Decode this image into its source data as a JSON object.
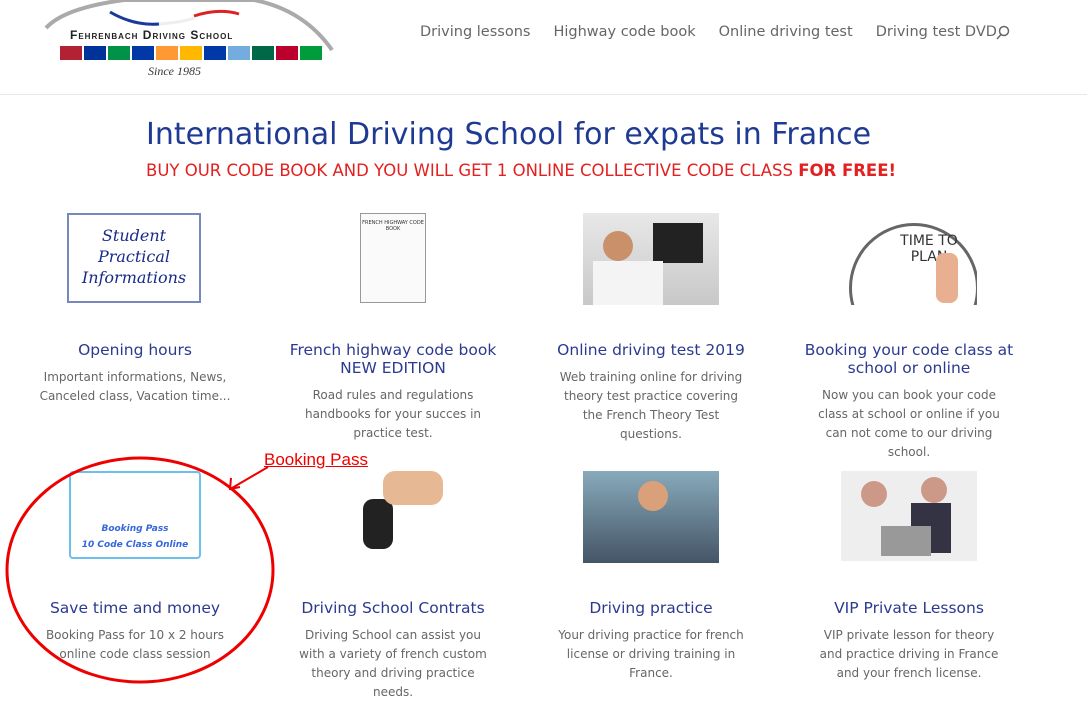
{
  "logo": {
    "name": "Fehrenbach Driving School",
    "since": "Since 1985",
    "flag_colors": [
      "#b22234",
      "#003399",
      "#009246",
      "#0039a6",
      "#ff9933",
      "#ffb700",
      "#0038a8",
      "#74acdf",
      "#006847",
      "#bc002d",
      "#009c3b"
    ]
  },
  "nav": [
    "Driving lessons",
    "Highway code book",
    "Online driving test",
    "Driving test DVD"
  ],
  "search_icon": "search-icon",
  "hero": {
    "title": "International Driving School for expats in France",
    "promo": "BUY OUR CODE BOOK AND YOU WILL GET 1 ONLINE COLLECTIVE CODE CLASS ",
    "promo_bold": "FOR FREE!"
  },
  "cards": [
    {
      "title": "Opening hours",
      "text": "Important informations, News, Canceled class, Vacation time...",
      "image_text": "Student Practical Informations"
    },
    {
      "title": "French highway code book NEW EDITION",
      "text": "Road rules and regulations handbooks for your succes in practice test.",
      "image_text": "FRENCH HIGHWAY CODE BOOK"
    },
    {
      "title": "Online driving test 2019",
      "text": "Web training online for driving theory test practice covering the French Theory Test questions."
    },
    {
      "title": "Booking your code class at school or online",
      "text": "Now you can book your code class at school or online if you can not come to our driving school.",
      "image_text": "TIME TO PLAN"
    },
    {
      "title": "Save time and money",
      "text": "Booking Pass for 10 x 2 hours online code class session",
      "image_text": "Booking Pass",
      "image_text2": "10 Code Class Online"
    },
    {
      "title": "Driving School Contrats",
      "text": "Driving School can assist you with a variety of french custom theory and driving practice needs."
    },
    {
      "title": "Driving practice",
      "text": "Your driving practice for french license or driving training in France."
    },
    {
      "title": "VIP Private Lessons",
      "text": "VIP private lesson for theory and practice driving in France and your french license."
    }
  ],
  "annotation": {
    "label": "Booking Pass",
    "color": "#e00000"
  }
}
